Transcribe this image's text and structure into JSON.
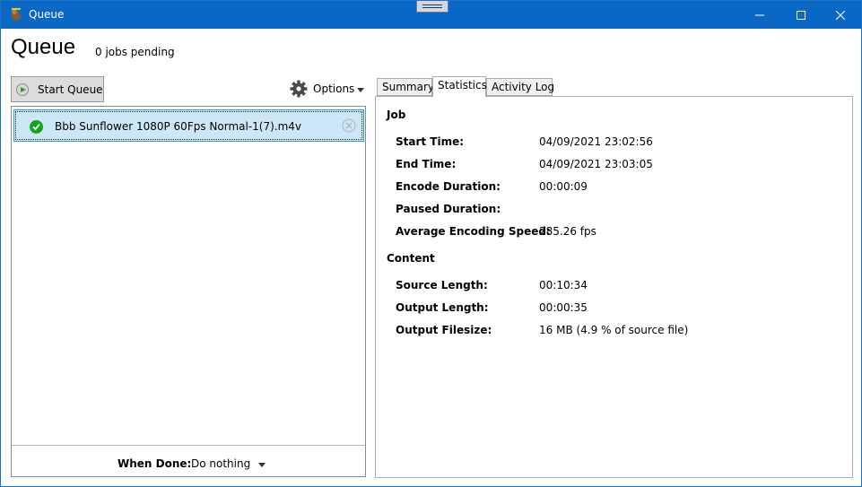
{
  "window": {
    "title": "Queue"
  },
  "header": {
    "title": "Queue",
    "pending": "0 jobs pending"
  },
  "toolbar": {
    "start_label": "Start Queue",
    "options_label": "Options"
  },
  "queue": {
    "items": [
      {
        "name": "Bbb Sunflower 1080P 60Fps Normal-1(7).m4v",
        "status": "completed"
      }
    ]
  },
  "when_done": {
    "label": "When Done:",
    "value": "Do nothing"
  },
  "tabs": [
    {
      "label": "Summary",
      "active": false
    },
    {
      "label": "Statistics",
      "active": true
    },
    {
      "label": "Activity Log",
      "active": false
    }
  ],
  "statistics": {
    "job_heading": "Job",
    "job_rows": [
      {
        "label": "Start Time:",
        "value": "04/09/2021 23:02:56"
      },
      {
        "label": "End Time:",
        "value": "04/09/2021 23:03:05"
      },
      {
        "label": "Encode Duration:",
        "value": "00:00:09"
      },
      {
        "label": "Paused Duration:",
        "value": ""
      },
      {
        "label": "Average Encoding Speed:",
        "value": "285.26 fps"
      }
    ],
    "content_heading": "Content",
    "content_rows": [
      {
        "label": "Source Length:",
        "value": "00:10:34"
      },
      {
        "label": "Output Length:",
        "value": "00:00:35"
      },
      {
        "label": "Output Filesize:",
        "value": "16 MB (4.9 % of source file)"
      }
    ]
  },
  "colors": {
    "titlebar": "#0b67c4",
    "selection": "#cce8f7",
    "selection_border": "#26a0da",
    "success": "#17a317"
  }
}
